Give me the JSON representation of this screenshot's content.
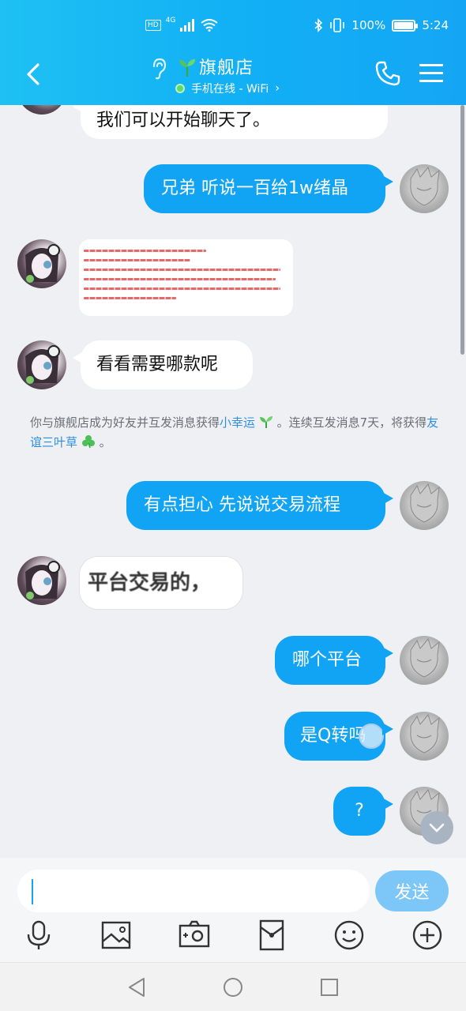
{
  "status_bar": {
    "hd": "HD",
    "network": "4G",
    "battery_percent": "100%",
    "battery_level": 1.0,
    "time": "5:24"
  },
  "header": {
    "title": "旗舰店",
    "presence": "手机在线 - WiFi",
    "icons": [
      "back-icon",
      "ear-icon",
      "sprout-icon",
      "phone-icon",
      "menu-icon"
    ]
  },
  "messages": [
    {
      "side": "in",
      "text": "我们可以开始聊天了。"
    },
    {
      "side": "out",
      "text": "兄弟 听说一百给1w绪晶"
    },
    {
      "side": "in",
      "type": "image"
    },
    {
      "side": "in",
      "text": "看看需要哪款呢"
    },
    {
      "side": "out",
      "text": "有点担心 先说说交易流程"
    },
    {
      "side": "in",
      "text": "平台交易的，"
    },
    {
      "side": "out",
      "text": "哪个平台"
    },
    {
      "side": "out",
      "text": "是Q转吗"
    },
    {
      "side": "out",
      "text": "?"
    }
  ],
  "notice": {
    "part1": "你与旗舰店成为好友并互发消息获得",
    "link1": "小幸运",
    "part2": "。连续互发消息7天，将获得",
    "link2": "友谊三叶草",
    "part3": "。"
  },
  "composer": {
    "input_value": "",
    "send_label": "发送",
    "tools": [
      "microphone-icon",
      "image-icon",
      "camera-icon",
      "red-envelope-icon",
      "emoji-icon",
      "plus-icon"
    ]
  },
  "colors": {
    "header": "#12b0f5",
    "bubble_out": "#12a4f4",
    "link": "#2f8ee0",
    "send": "#7cc7f7"
  }
}
